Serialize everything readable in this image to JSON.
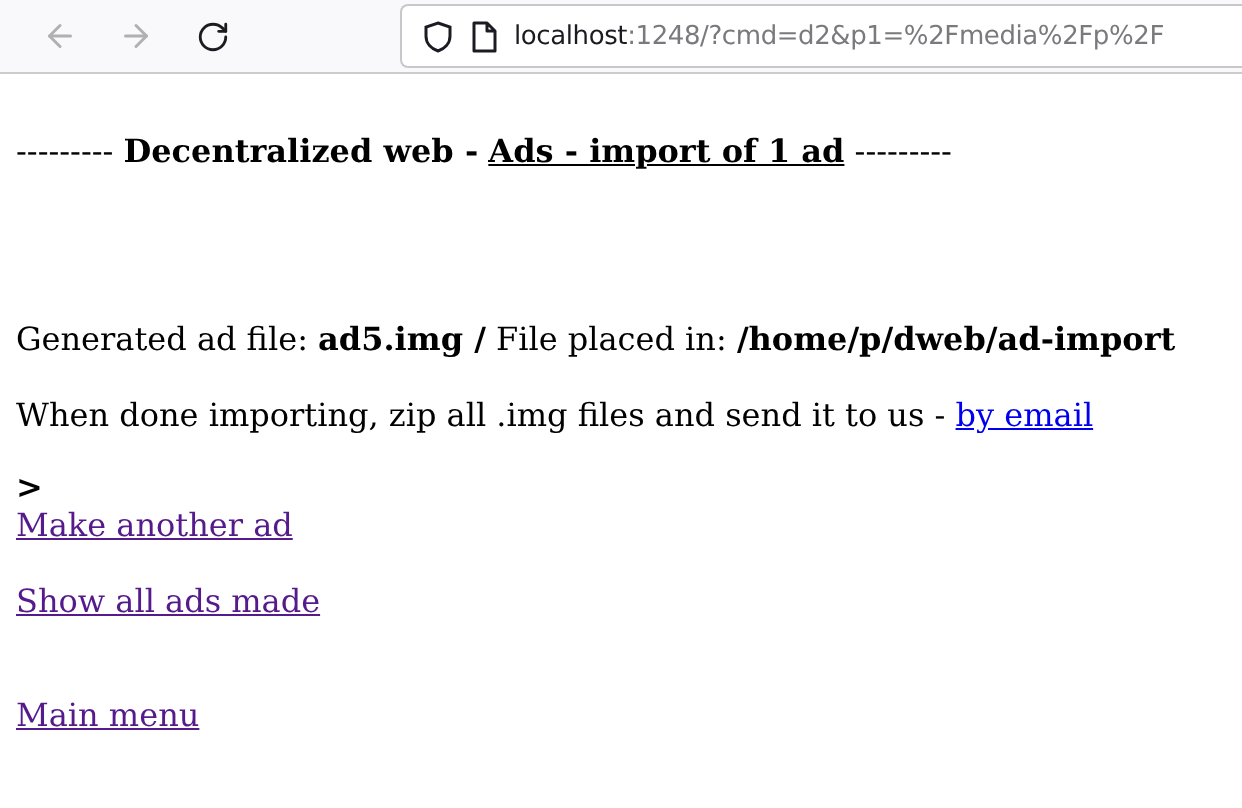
{
  "browser": {
    "back_disabled": true,
    "forward_disabled": true,
    "url_host": "localhost",
    "url_rest": ":1248/?cmd=d2&p1=%2Fmedia%2Fp%2F"
  },
  "heading": {
    "prefix": "---------",
    "title": "Decentralized web -",
    "link": "Ads - import of 1 ad",
    "suffix": "---------"
  },
  "paragraphs": [
    {
      "text": "Generated ad file: **ad5.img /** File placed in: **/home/p/dweb/ad-import**"
    },
    {
      "text": "When done importing, zip all .img files and send it to us -",
      "link": {
        "label": "by email",
        "visited": false
      }
    }
  ],
  "prompt": ">",
  "links": [
    {
      "label": "Make another ad",
      "visited": true
    },
    {
      "label": "Show all ads made",
      "visited": true
    },
    {
      "label": "Main menu",
      "visited": true
    }
  ]
}
